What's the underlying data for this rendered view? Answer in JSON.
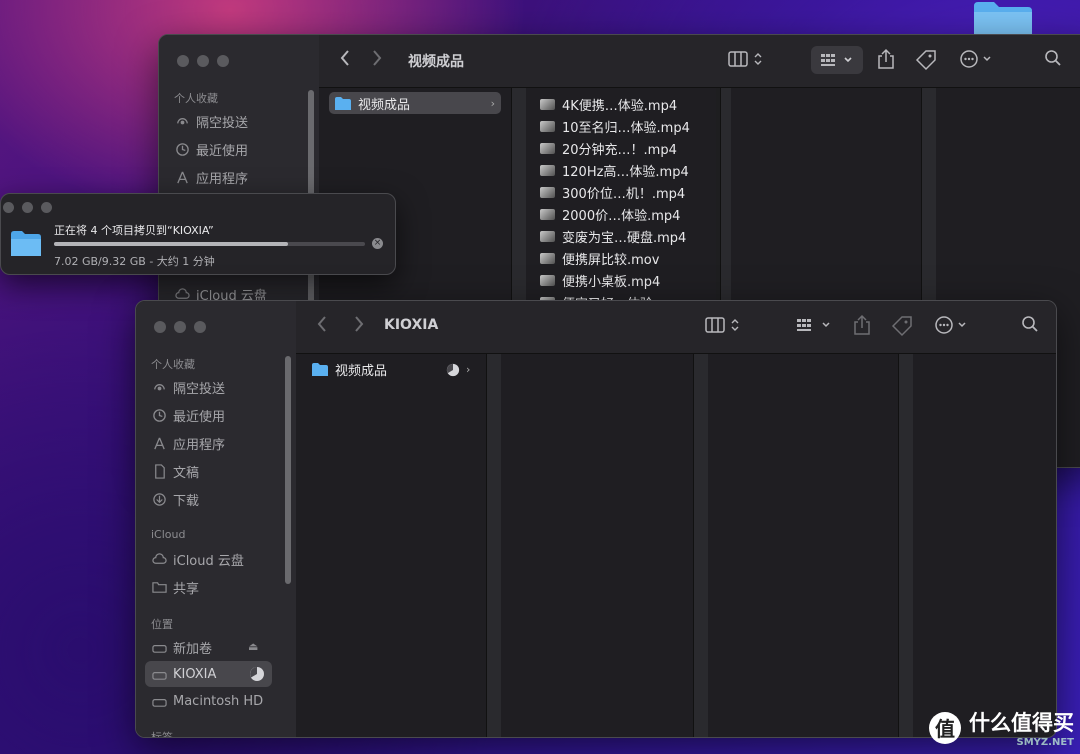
{
  "colors": {
    "accent_folder": "#5ab0f0",
    "window_bg": "#1e1e20",
    "sidebar_bg": "#2b2a2f"
  },
  "window_back": {
    "title": "视频成品",
    "sidebar": {
      "section_favorites": "个人收藏",
      "items": [
        {
          "label": "隔空投送",
          "icon": "airdrop-icon"
        },
        {
          "label": "最近使用",
          "icon": "clock-icon"
        },
        {
          "label": "应用程序",
          "icon": "apps-icon"
        },
        {
          "label": "iCloud 云盘",
          "icon": "cloud-icon"
        }
      ]
    },
    "column1": [
      {
        "name": "视频成品",
        "icon": "folder-icon"
      }
    ],
    "column2": [
      "4K便携…体验.mp4",
      "10至名归…体验.mp4",
      "20分钟充…！.mp4",
      "120Hz高…体验.mp4",
      "300价位…机！.mp4",
      "2000价…体验.mp4",
      "变废为宝…硬盘.mp4",
      "便携屏比较.mov",
      "便携小桌板.mp4",
      "便宜又好…体验.mov"
    ]
  },
  "copy_progress": {
    "title": "正在将 4 个项目拷贝到“KIOXIA”",
    "status": "7.02 GB/9.32 GB - 大约 1 分钟",
    "fraction": 0.753
  },
  "window_front": {
    "title": "KIOXIA",
    "sidebar": {
      "section_favorites": "个人收藏",
      "favorites": [
        {
          "label": "隔空投送",
          "icon": "airdrop-icon"
        },
        {
          "label": "最近使用",
          "icon": "clock-icon"
        },
        {
          "label": "应用程序",
          "icon": "apps-icon"
        },
        {
          "label": "文稿",
          "icon": "document-icon"
        },
        {
          "label": "下载",
          "icon": "download-icon"
        }
      ],
      "section_icloud": "iCloud",
      "icloud": [
        {
          "label": "iCloud 云盘",
          "icon": "cloud-icon"
        },
        {
          "label": "共享",
          "icon": "shared-folder-icon"
        }
      ],
      "section_locations": "位置",
      "locations": [
        {
          "label": "新加卷",
          "icon": "drive-icon"
        },
        {
          "label": "KIOXIA",
          "icon": "drive-icon"
        },
        {
          "label": "Macintosh HD",
          "icon": "drive-icon"
        }
      ],
      "section_tags": "标签"
    },
    "column1": [
      {
        "name": "视频成品",
        "icon": "folder-icon"
      }
    ]
  },
  "watermark": {
    "char": "值",
    "text": "什么值得买",
    "sub": "SMYZ.NET"
  }
}
